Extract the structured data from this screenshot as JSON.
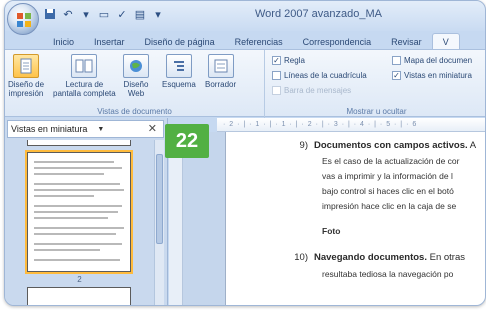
{
  "window": {
    "title": "Word 2007 avanzado_MA"
  },
  "tabs": [
    "Inicio",
    "Insertar",
    "Diseño de página",
    "Referencias",
    "Correspondencia",
    "Revisar",
    "V"
  ],
  "ribbon": {
    "views": {
      "buttons": [
        {
          "label": "Diseño de\nimpresión",
          "active": true
        },
        {
          "label": "Lectura de\npantalla completa",
          "active": false
        },
        {
          "label": "Diseño\nWeb",
          "active": false
        },
        {
          "label": "Esquema",
          "active": false
        },
        {
          "label": "Borrador",
          "active": false
        }
      ],
      "group_label": "Vistas de documento"
    },
    "show": {
      "items": [
        {
          "label": "Regla",
          "checked": true,
          "enabled": true
        },
        {
          "label": "Líneas de la cuadrícula",
          "checked": false,
          "enabled": true
        },
        {
          "label": "Barra de mensajes",
          "checked": false,
          "enabled": false
        },
        {
          "label": "Mapa del documen",
          "checked": false,
          "enabled": true
        },
        {
          "label": "Vistas en miniatura",
          "checked": true,
          "enabled": true
        }
      ],
      "group_label": "Mostrar u ocultar"
    }
  },
  "pane": {
    "title": "Vistas en miniatura",
    "page_number": "2"
  },
  "badge": "22",
  "ruler_text": "· 2 · | · 1 · | · 1 · | · 2 · | · 3 · | · 4 · | · 5 · | · 6",
  "document": {
    "item9": {
      "num": "9)",
      "title": "Documentos con campos activos.",
      "rest": " A"
    },
    "item9_lines": [
      "Es el caso de la actualización de cor",
      "vas a imprimir y la información de l",
      "bajo control si haces clic en el botó",
      "impresión hace clic en la caja de se"
    ],
    "foto": "Foto",
    "item10": {
      "num": "10)",
      "title": "Navegando documentos.",
      "rest": " En otras"
    },
    "item10_lines": [
      "resultaba tediosa la navegación po"
    ]
  },
  "colors": {
    "badge": "#52b043",
    "ribbon": "#dde8f6",
    "selection": "#ffbb3c"
  }
}
